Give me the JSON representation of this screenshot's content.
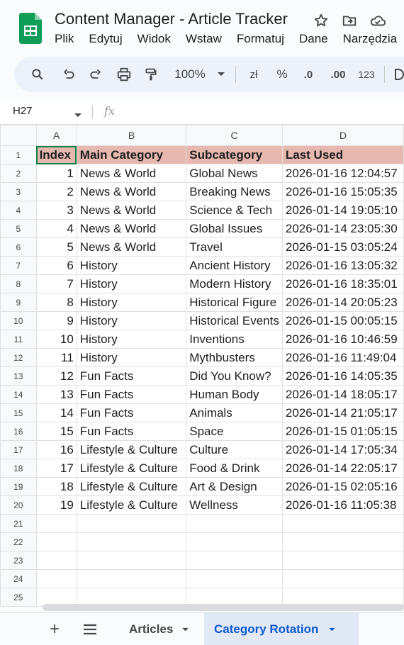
{
  "app": {
    "doc_title": "Content Manager - Article Tracker",
    "menu": [
      "Plik",
      "Edytuj",
      "Widok",
      "Wstaw",
      "Formatuj",
      "Dane",
      "Narzędzia"
    ]
  },
  "toolbar": {
    "zoom": "100%",
    "currency_label": "zł",
    "percent_label": "%",
    "decrease_decimals_label": ".0",
    "increase_decimals_label": ".00",
    "number_format_label": "123"
  },
  "formula_bar": {
    "cell_ref": "H27",
    "fx_label": "fx"
  },
  "grid": {
    "columns": [
      "A",
      "B",
      "C",
      "D"
    ],
    "header": [
      "Index",
      "Main Category",
      "Subcategory",
      "Last Used"
    ],
    "rows": [
      {
        "index": "1",
        "main": "News & World",
        "sub": "Global News",
        "last": "2026-01-16 12:04:57"
      },
      {
        "index": "2",
        "main": "News & World",
        "sub": "Breaking News",
        "last": "2026-01-16 15:05:35"
      },
      {
        "index": "3",
        "main": "News & World",
        "sub": "Science & Tech",
        "last": "2026-01-14 19:05:10"
      },
      {
        "index": "4",
        "main": "News & World",
        "sub": "Global Issues",
        "last": "2026-01-14 23:05:30"
      },
      {
        "index": "5",
        "main": "News & World",
        "sub": "Travel",
        "last": "2026-01-15 03:05:24"
      },
      {
        "index": "6",
        "main": "History",
        "sub": "Ancient History",
        "last": "2026-01-16 13:05:32"
      },
      {
        "index": "7",
        "main": "History",
        "sub": "Modern History",
        "last": "2026-01-16 18:35:01"
      },
      {
        "index": "8",
        "main": "History",
        "sub": "Historical Figure",
        "last": "2026-01-14 20:05:23"
      },
      {
        "index": "9",
        "main": "History",
        "sub": "Historical Events",
        "last": "2026-01-15 00:05:15"
      },
      {
        "index": "10",
        "main": "History",
        "sub": "Inventions",
        "last": "2026-01-16 10:46:59"
      },
      {
        "index": "11",
        "main": "History",
        "sub": "Mythbusters",
        "last": "2026-01-16 11:49:04"
      },
      {
        "index": "12",
        "main": "Fun Facts",
        "sub": "Did You Know?",
        "last": "2026-01-16 14:05:35"
      },
      {
        "index": "13",
        "main": "Fun Facts",
        "sub": "Human Body",
        "last": "2026-01-14 18:05:17"
      },
      {
        "index": "14",
        "main": "Fun Facts",
        "sub": "Animals",
        "last": "2026-01-14 21:05:17"
      },
      {
        "index": "15",
        "main": "Fun Facts",
        "sub": "Space",
        "last": "2026-01-15 01:05:15"
      },
      {
        "index": "16",
        "main": "Lifestyle & Culture",
        "sub": "Culture",
        "last": "2026-01-14 17:05:34"
      },
      {
        "index": "17",
        "main": "Lifestyle & Culture",
        "sub": "Food & Drink",
        "last": "2026-01-14 22:05:17"
      },
      {
        "index": "18",
        "main": "Lifestyle & Culture",
        "sub": "Art & Design",
        "last": "2026-01-15 02:05:16"
      },
      {
        "index": "19",
        "main": "Lifestyle & Culture",
        "sub": "Wellness",
        "last": "2026-01-16 11:05:38"
      }
    ],
    "empty_row_numbers": [
      "21",
      "22",
      "23",
      "24",
      "25"
    ]
  },
  "sheets": {
    "tabs": [
      "Articles",
      "Category Rotation"
    ],
    "active": "Category Rotation"
  },
  "colors": {
    "header_fill": "#e6b8af",
    "active_tab_text": "#0b57d0",
    "active_tab_bg": "#e1e9f7",
    "selection": "#0b8043"
  }
}
